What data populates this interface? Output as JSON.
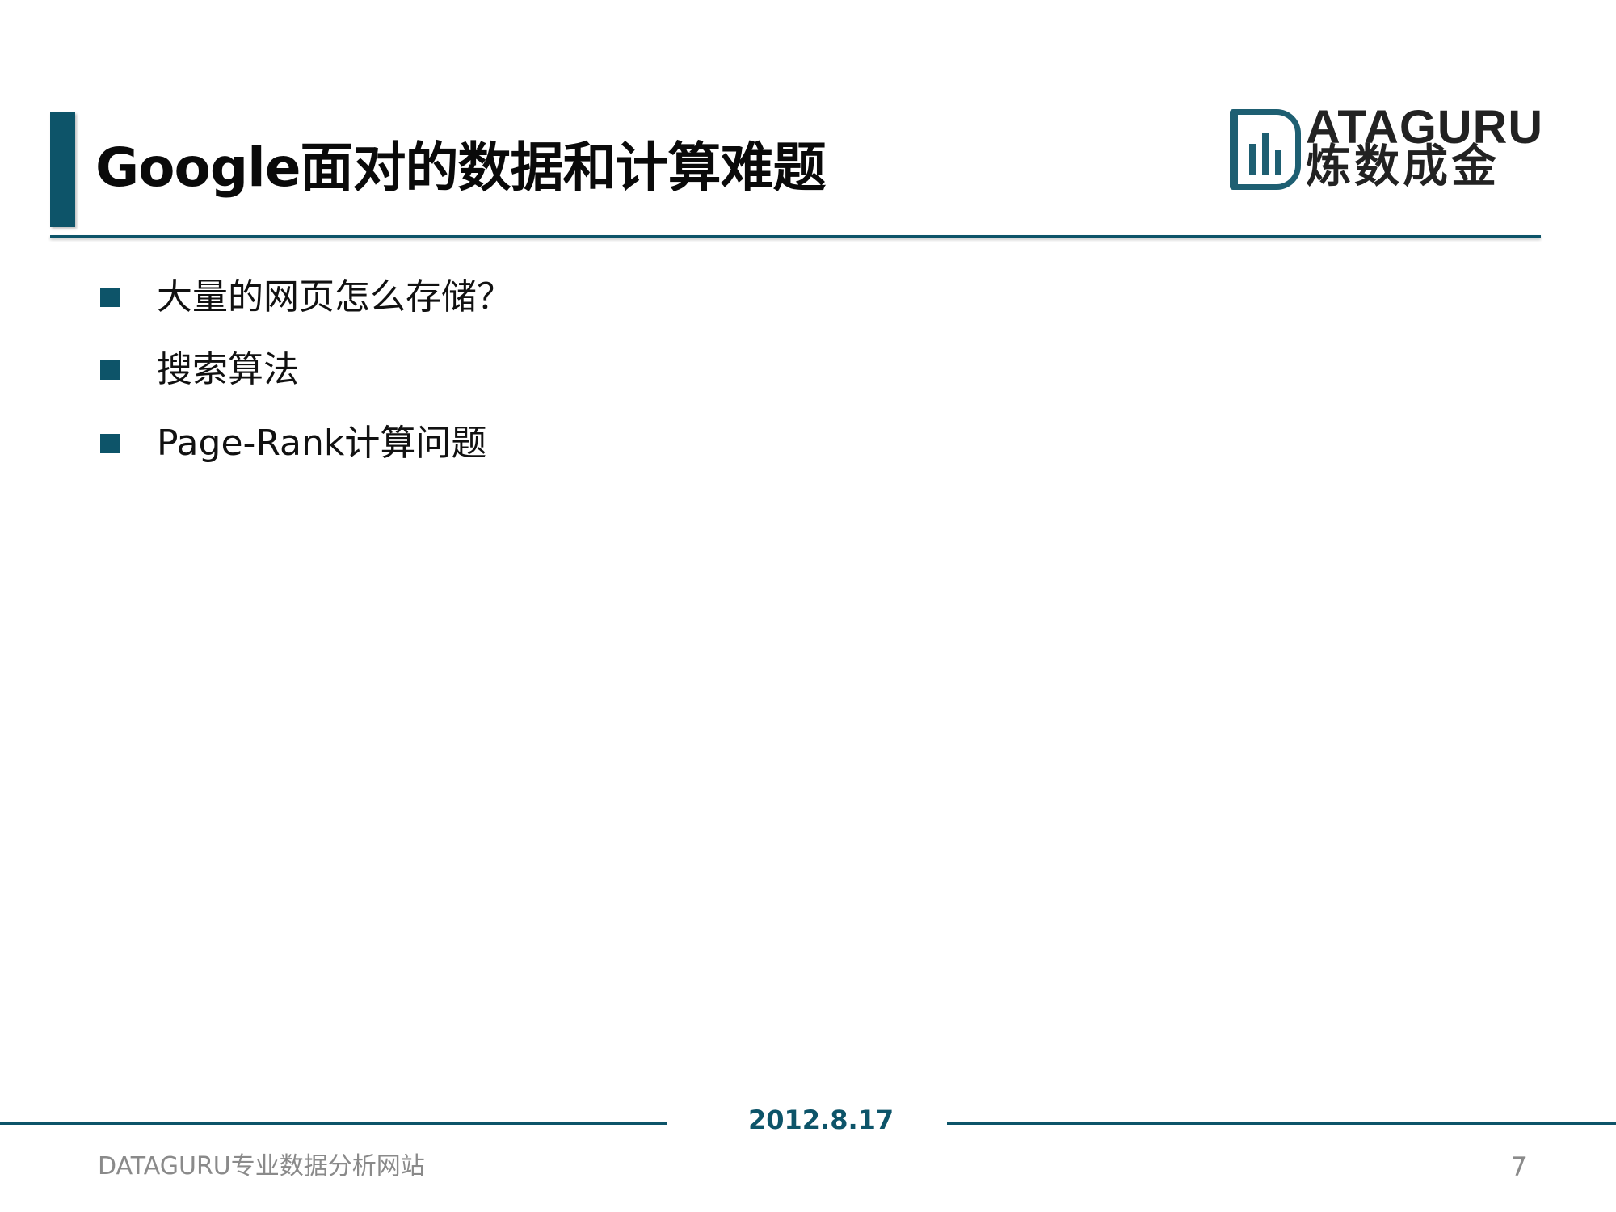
{
  "slide": {
    "title": "Google面对的数据和计算难题",
    "logo": {
      "text_en": "ATAGURU",
      "text_cn": "炼数成金",
      "icon": "bar-chart-d-icon"
    },
    "bullets": [
      {
        "text": "大量的网页怎么存储？"
      },
      {
        "text": "搜索算法"
      },
      {
        "text": "Page-Rank计算问题"
      }
    ],
    "footer": {
      "date": "2012.8.17",
      "site": "DATAGURU专业数据分析网站",
      "page_number": "7"
    },
    "colors": {
      "accent": "#0d5469",
      "footer_text": "#8a8a8a"
    }
  }
}
